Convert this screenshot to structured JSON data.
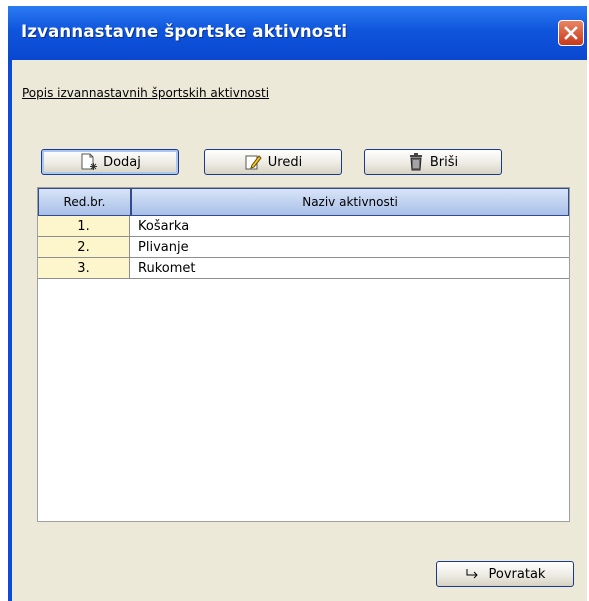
{
  "window": {
    "title": "Izvannastavne športske aktivnosti"
  },
  "section_label": "Popis  izvannastavnih športskih aktivnosti",
  "toolbar": {
    "add_label": "Dodaj",
    "edit_label": "Uredi",
    "delete_label": "Briši"
  },
  "table": {
    "headers": [
      "Red.br.",
      "Naziv aktivnosti"
    ],
    "rows": [
      {
        "num": "1.",
        "name": "Košarka"
      },
      {
        "num": "2.",
        "name": "Plivanje"
      },
      {
        "num": "3.",
        "name": "Rukomet"
      }
    ]
  },
  "footer": {
    "back_label": "Povratak"
  },
  "icons": {
    "add": "new-document-icon",
    "edit": "pencil-note-icon",
    "delete": "trash-can-icon",
    "back": "return-arrow-icon",
    "close": "close-icon"
  },
  "colors": {
    "titlebar": "#0f55dc",
    "client": "#ece9d8",
    "close_button": "#d9532f",
    "row_number_bg": "#fdf6cc",
    "header_bg": "#b7cbee"
  }
}
